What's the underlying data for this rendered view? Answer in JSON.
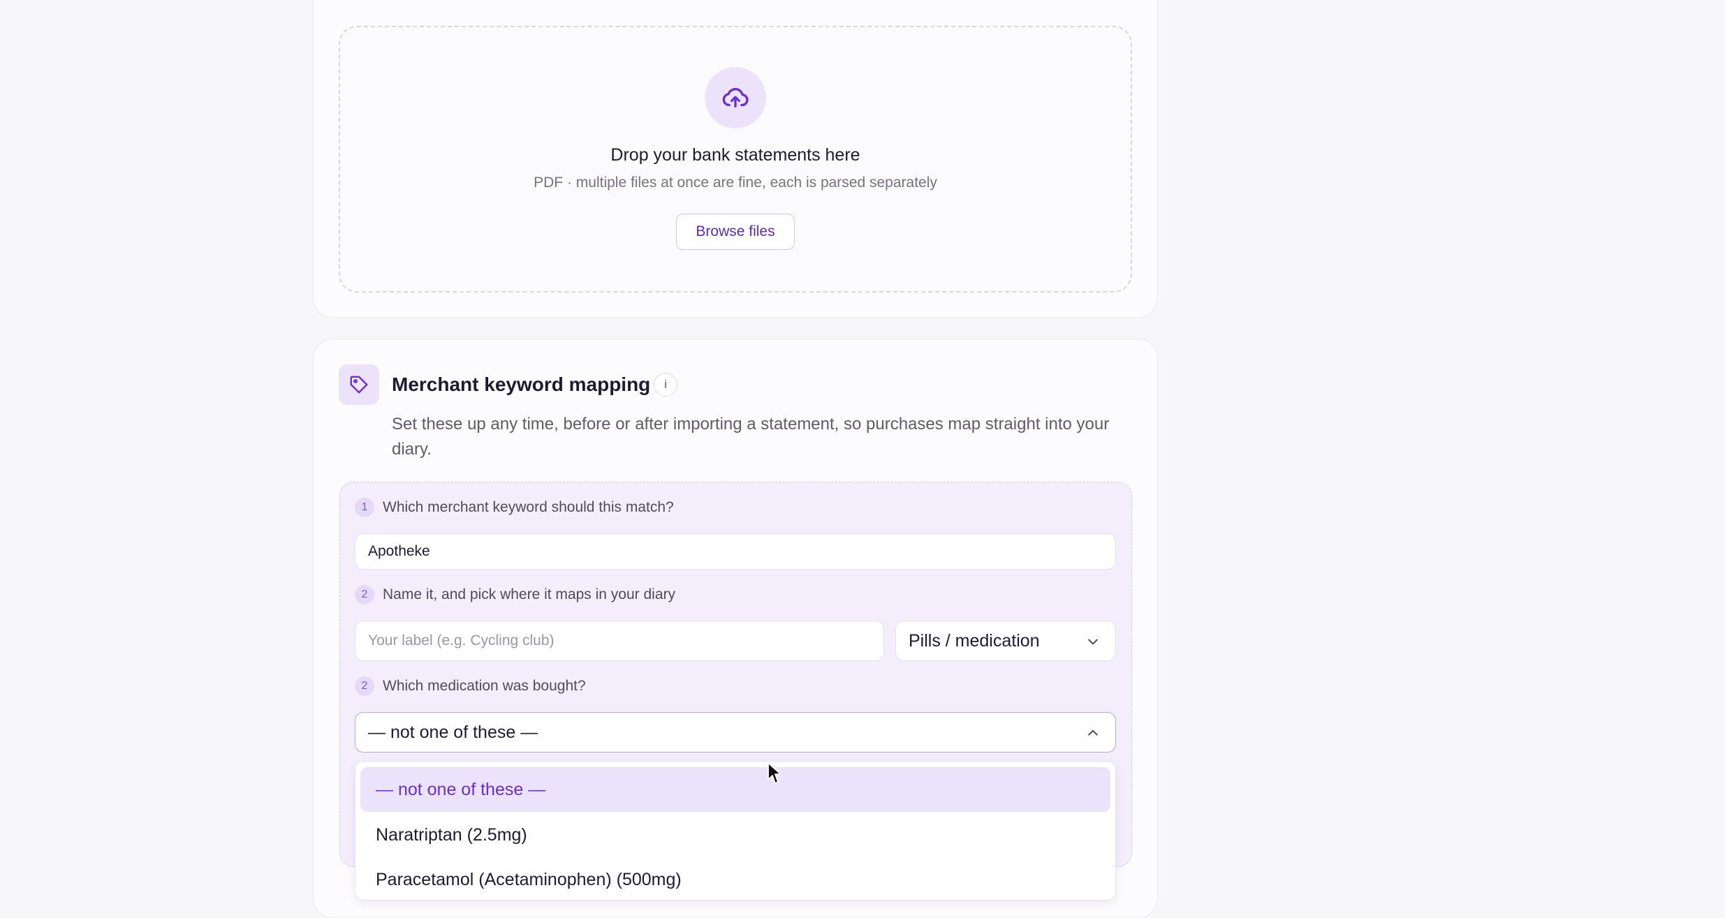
{
  "upload": {
    "title": "Drop your bank statements here",
    "subtitle": "PDF · multiple files at once are fine, each is parsed separately",
    "browse_label": "Browse files",
    "icon": "cloud-upload-icon"
  },
  "mapping": {
    "icon": "tag-icon",
    "title": "Merchant keyword mapping",
    "info_label": "i",
    "description": "Set these up any time, before or after importing a statement, so purchases map straight into your diary.",
    "step1": {
      "number": "1",
      "label": "Which merchant keyword should this match?",
      "value": "Apotheke"
    },
    "step2": {
      "number": "2",
      "label": "Name it, and pick where it maps in your diary",
      "label_placeholder": "Your label (e.g. Cycling club)",
      "category_value": "Pills / medication"
    },
    "step3": {
      "number": "2",
      "label": "Which medication was bought?",
      "selected": "— not one of these —",
      "options": [
        "— not one of these —",
        "Naratriptan (2.5mg)",
        "Paracetamol (Acetaminophen) (500mg)"
      ]
    }
  },
  "colors": {
    "accent": "#6a2fd0",
    "accent_bg": "#ebe2fb",
    "panel_bg": "#f4eefc"
  }
}
